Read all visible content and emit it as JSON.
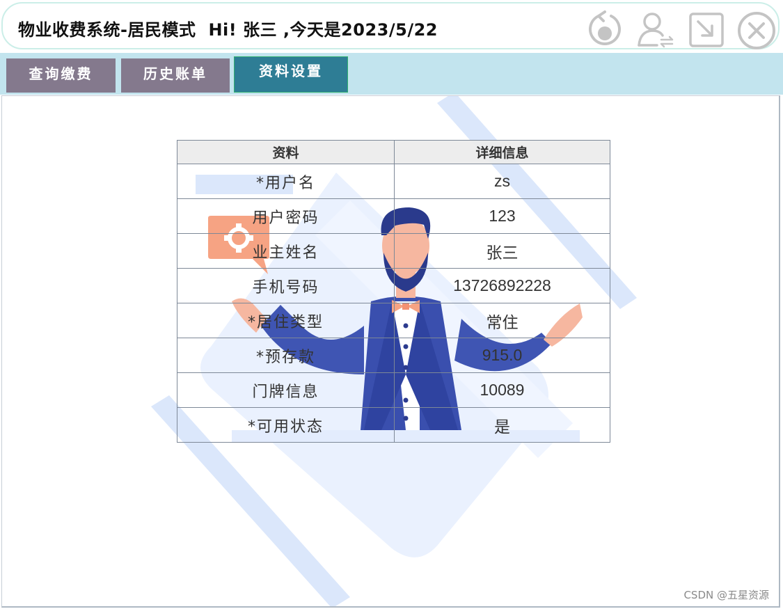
{
  "header": {
    "title": "物业收费系统-居民模式",
    "greeting": "Hi! 张三 ,今天是2023/5/22",
    "icons": [
      "refresh-icon",
      "switch-user-icon",
      "minimize-icon",
      "close-icon"
    ]
  },
  "tabs": [
    {
      "label": "查询缴费",
      "active": false
    },
    {
      "label": "历史账单",
      "active": false
    },
    {
      "label": "资料设置",
      "active": true
    }
  ],
  "profile_table": {
    "headers": [
      "资料",
      "详细信息"
    ],
    "rows": [
      {
        "label": "*用户名",
        "value": "zs"
      },
      {
        "label": "用户密码",
        "value": "123"
      },
      {
        "label": "业主姓名",
        "value": "张三"
      },
      {
        "label": "手机号码",
        "value": "13726892228"
      },
      {
        "label": "*居住类型",
        "value": "常住"
      },
      {
        "label": "*预存款",
        "value": "915.0"
      },
      {
        "label": "门牌信息",
        "value": "10089"
      },
      {
        "label": "*可用状态",
        "value": "是"
      }
    ]
  },
  "watermark": "CSDN @五星资源",
  "colors": {
    "tab_inactive": "#84798d",
    "tab_active": "#2e7d95",
    "tabbar_bg": "#c2e4ee",
    "title_border": "#cbeee8",
    "icon_gray": "#c4c4c4"
  }
}
